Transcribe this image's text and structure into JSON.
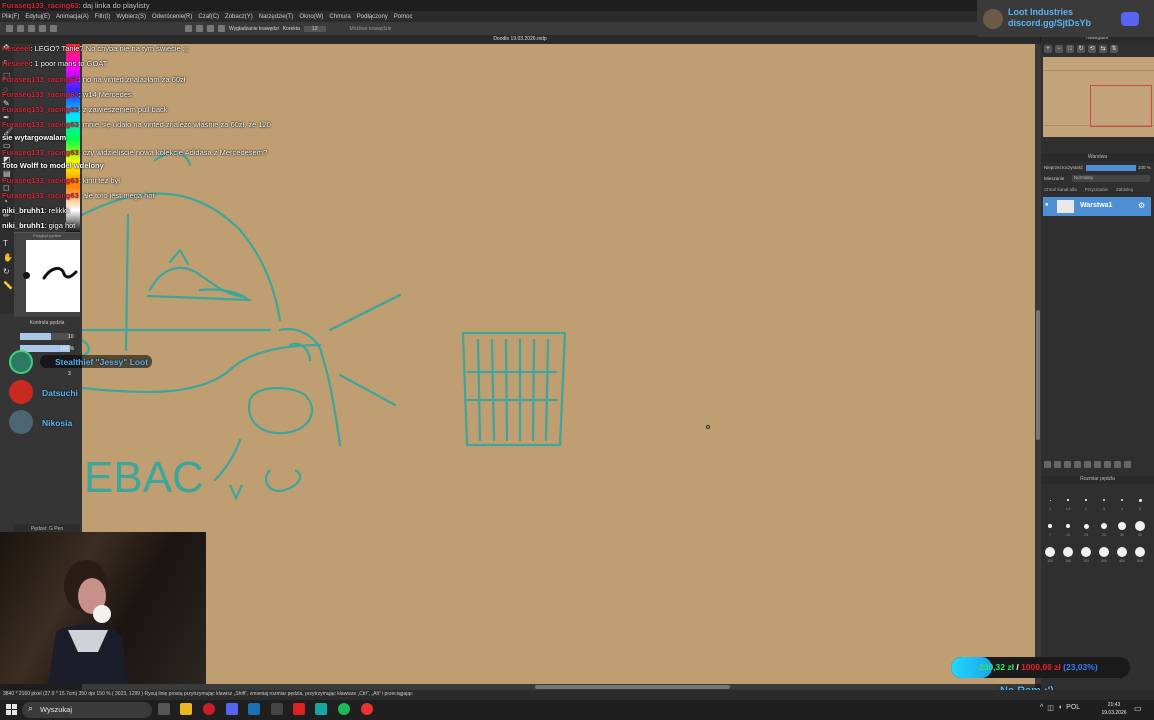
{
  "window_title": {
    "user": "Furaseq133_racing63",
    "rest": ": daj linka do playlisty"
  },
  "menu": [
    "Plik(F)",
    "Edytuj(E)",
    "Animacja(A)",
    "Filtr(I)",
    "Wybierz(S)",
    "Odwrócenie(R)",
    "Czaf(C)",
    "Zobacz(Y)",
    "Narzędzie(T)",
    "Okno(W)",
    "Chmura",
    "Podłączony",
    "Pomoc"
  ],
  "tool_options": {
    "rotate_label": "Wygładzanie krawędzi",
    "correction_label": "Korekta",
    "correction_value": "13",
    "undo_label": "Możliwe krawędzie"
  },
  "document_title": "Doodle 19.03.2026.mdp",
  "chat": [
    {
      "user": "Heseeei",
      "msg": ": LEGO? Tanie? No chyba nie na tym świecie ;;;",
      "user_color": "red"
    },
    {
      "user": "Heseeei",
      "msg": ": 1 poor mans to GOAT",
      "user_color": "red"
    },
    {
      "user": "Furaseq133_racing63",
      "msg": ": no na vinted znalazłam za 60zł",
      "user_color": "red"
    },
    {
      "user": "Furaseq133_racing63",
      "msg": ": w14 Mercedes",
      "user_color": "red"
    },
    {
      "user": "Furaseq133_racing63",
      "msg": ": z zawieszeniem pull back",
      "user_color": "red"
    },
    {
      "user": "Furaseq133_racing63",
      "msg": ": mnie się udało na vinted znaleźć właśnie za 60zł. ze 120",
      "user_color": "red"
    },
    {
      "user": "",
      "msg": "sie wytargowalam",
      "user_color": "white"
    },
    {
      "user": "Furaseq133_racing63",
      "msg": ": czy widzieliście nową kolekcje Adidasa z Mercedesem?",
      "user_color": "red"
    },
    {
      "user": "",
      "msg": "Toto Wolff to model wdelony",
      "user_color": "white"
    },
    {
      "user": "Furaseq133_racing63",
      "msg": ": kimi tez był",
      "user_color": "red"
    },
    {
      "user": "Furaseq133_racing63",
      "msg": ": ale toto jest mega hot",
      "user_color": "red"
    },
    {
      "user": "niki_bruhh1",
      "msg": ": relikkk",
      "user_color": "white"
    },
    {
      "user": "niki_bruhh1",
      "msg": ": giga hot",
      "user_color": "white"
    }
  ],
  "participants": [
    {
      "name": "Stealthief \"Jessy\" Loot",
      "speaking": true,
      "avatar_color": "#2d7a63"
    },
    {
      "name": "Datsuchi",
      "speaking": false,
      "avatar_color": "#c92a1f"
    },
    {
      "name": "Nikosia",
      "speaking": false,
      "avatar_color": "#4b6670"
    }
  ],
  "left_panel": {
    "subtool_title": "Podgląd pędzla",
    "brush_control_title": "Kontrola pędzla",
    "size_value": "10",
    "opacity_value": "100 %",
    "step_value": "3",
    "bottom_label": "Pędzel: G Pen"
  },
  "canvas": {
    "text": "EBAC",
    "bg_color": "#bf9f72",
    "stroke_color": "#3da59b"
  },
  "navigator": {
    "title": "Nawigator"
  },
  "layers": {
    "title": "Warstwa",
    "opacity_label": "Nieprzezroczystość",
    "opacity_value": "100 %",
    "opacity_fraction": 1.0,
    "blend_label": "Mieszanie",
    "blend_value": "Normalny",
    "options": [
      "Chroń kanał alfa",
      "Przycinanie",
      "Zablokuj"
    ],
    "layer_name": "Warstwa1"
  },
  "brush_size": {
    "title": "Rozmiar pędzla",
    "sizes": [
      "1",
      "1.5",
      "2",
      "3",
      "4",
      "5",
      "7",
      "10",
      "15",
      "20",
      "30",
      "40",
      "100",
      "150",
      "200",
      "300",
      "400",
      "500"
    ]
  },
  "sponsor": {
    "name": "Loot Industries",
    "link": "discord.gg/SjtDsYb"
  },
  "goal": {
    "current": "230,32 zł",
    "separator": " / ",
    "target": "1000,00 zł",
    "percent": "(23,03%)",
    "fraction": 0.2303
  },
  "subtitle": "Na Ram :')",
  "status": {
    "text": "3840 * 2160 pixel   (27.9 * 15.7cm)   350 dpi   150 %   ( 3023, 1299 )   Rysuj linię prostą przytrzymując klawisz „Shift”, zmieniaj rozmiar pędzla, przytrzymując klawisze „Ctrl”, „Alt” i przeciągając"
  },
  "taskbar": {
    "search_placeholder": "Wyszukaj",
    "clock_time": "21:43",
    "clock_date": "19.03.2026",
    "lang": "POL"
  }
}
